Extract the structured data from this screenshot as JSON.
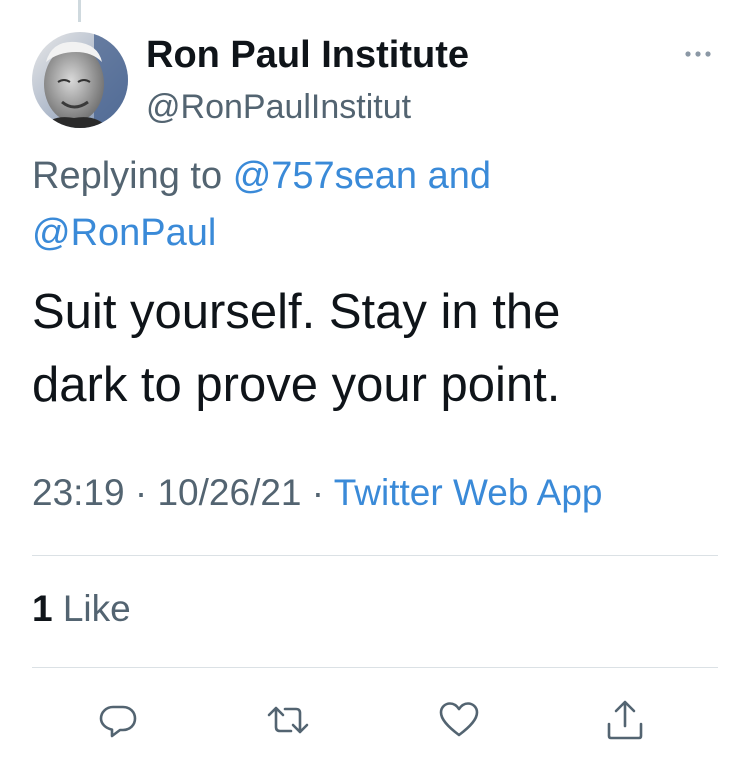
{
  "tweet": {
    "author": {
      "display_name": "Ron Paul Institute",
      "handle": "@RonPaulInstitut",
      "avatar_icon": "profile-photo"
    },
    "replying_to": {
      "prefix": "Replying to",
      "mention_1": "@757sean",
      "conjunction": "and",
      "mention_2": "@RonPaul"
    },
    "text_line_1": "Suit yourself. Stay in the",
    "text_line_2": "dark to prove your point.",
    "time": "23:19",
    "date": "10/26/21",
    "separator": "·",
    "source": "Twitter Web App",
    "likes": {
      "count": "1",
      "label": "Like"
    }
  },
  "actions": {
    "reply_icon": "comment-icon",
    "retweet_icon": "retweet-icon",
    "like_icon": "heart-icon",
    "share_icon": "share-icon"
  },
  "colors": {
    "link": "#3a8ad8",
    "secondary_text": "#536471",
    "primary_text": "#0f1419",
    "divider": "#dbe1e5"
  }
}
